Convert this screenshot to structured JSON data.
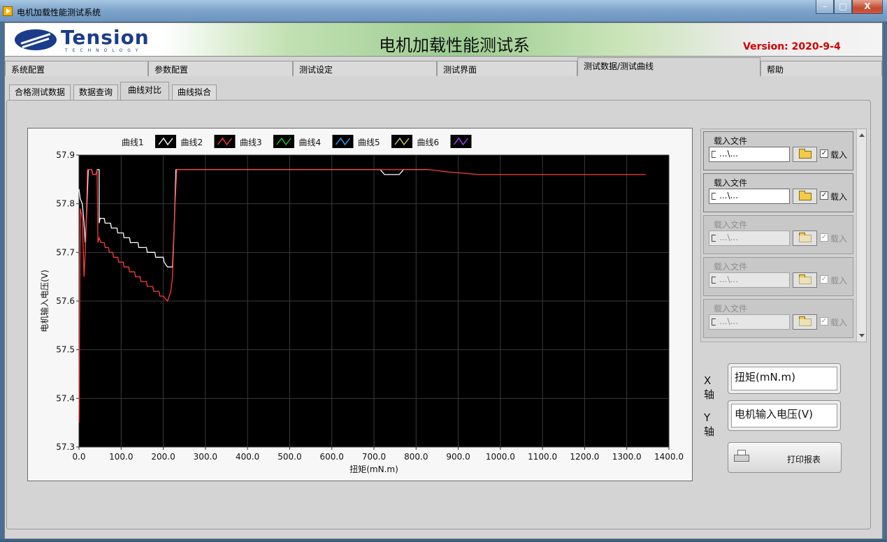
{
  "window": {
    "title": "电机加载性能测试系统",
    "controls": {
      "minimize": "–",
      "maximize": "□",
      "close": "X"
    }
  },
  "header": {
    "logo_text": "Tension",
    "logo_subtext": "TECHNOLOGY",
    "app_title": "电机加载性能测试系",
    "version": "Version: 2020-9-4"
  },
  "top_tabs": [
    "系统配置",
    "参数配置",
    "测试设定",
    "测试界面",
    "测试数据/测试曲线",
    "帮助"
  ],
  "top_tab_active": "测试数据/测试曲线",
  "sub_tabs": [
    "合格测试数据",
    "数据查询",
    "曲线对比",
    "曲线拟合"
  ],
  "sub_tab_active": "曲线对比",
  "legend": [
    "曲线1",
    "曲线2",
    "曲线3",
    "曲线4",
    "曲线5",
    "曲线6"
  ],
  "colors": {
    "plot_bg": "#000000",
    "curve1": "#ffffff",
    "curve2": "#ff3b3b",
    "curve3": "#22cc22",
    "curve4": "#3aa0ff",
    "curve5": "#cfcf5a",
    "curve6": "#b040ff"
  },
  "chart_data": {
    "type": "line",
    "xlabel": "扭矩(mN.m)",
    "ylabel": "电机输入电压(V)",
    "xlim": [
      0,
      1400
    ],
    "ylim": [
      57.3,
      57.9
    ],
    "x_ticks": [
      "0.0",
      "100.0",
      "200.0",
      "300.0",
      "400.0",
      "500.0",
      "600.0",
      "700.0",
      "800.0",
      "900.0",
      "1000.0",
      "1100.0",
      "1200.0",
      "1300.0",
      "1400.0"
    ],
    "y_ticks": [
      "57.3",
      "57.4",
      "57.5",
      "57.6",
      "57.7",
      "57.8",
      "57.9"
    ],
    "grid": true,
    "legend_position": "top",
    "series": [
      {
        "name": "曲线1",
        "points": [
          [
            0,
            57.83
          ],
          [
            3,
            57.81
          ],
          [
            8,
            57.8
          ],
          [
            12,
            57.76
          ],
          [
            15,
            57.72
          ],
          [
            18,
            57.78
          ],
          [
            22,
            57.87
          ],
          [
            30,
            57.87
          ],
          [
            33,
            57.86
          ],
          [
            40,
            57.86
          ],
          [
            43,
            57.87
          ],
          [
            48,
            57.87
          ],
          [
            48,
            57.76
          ],
          [
            50,
            57.77
          ],
          [
            60,
            57.77
          ],
          [
            62,
            57.76
          ],
          [
            75,
            57.76
          ],
          [
            77,
            57.75
          ],
          [
            90,
            57.75
          ],
          [
            92,
            57.74
          ],
          [
            105,
            57.74
          ],
          [
            107,
            57.73
          ],
          [
            120,
            57.73
          ],
          [
            122,
            57.72
          ],
          [
            140,
            57.72
          ],
          [
            142,
            57.71
          ],
          [
            160,
            57.71
          ],
          [
            162,
            57.7
          ],
          [
            180,
            57.7
          ],
          [
            182,
            57.69
          ],
          [
            200,
            57.69
          ],
          [
            202,
            57.68
          ],
          [
            210,
            57.67
          ],
          [
            222,
            57.67
          ],
          [
            226,
            57.75
          ],
          [
            230,
            57.87
          ],
          [
            715,
            57.87
          ],
          [
            725,
            57.86
          ],
          [
            760,
            57.86
          ],
          [
            770,
            57.87
          ],
          [
            830,
            57.87
          ]
        ]
      },
      {
        "name": "曲线2",
        "points": [
          [
            0,
            57.35
          ],
          [
            3,
            57.79
          ],
          [
            8,
            57.77
          ],
          [
            12,
            57.65
          ],
          [
            16,
            57.72
          ],
          [
            20,
            57.87
          ],
          [
            30,
            57.87
          ],
          [
            33,
            57.86
          ],
          [
            40,
            57.86
          ],
          [
            43,
            57.87
          ],
          [
            45,
            57.72
          ],
          [
            48,
            57.73
          ],
          [
            52,
            57.72
          ],
          [
            60,
            57.72
          ],
          [
            62,
            57.71
          ],
          [
            70,
            57.71
          ],
          [
            72,
            57.7
          ],
          [
            80,
            57.7
          ],
          [
            82,
            57.69
          ],
          [
            92,
            57.69
          ],
          [
            94,
            57.68
          ],
          [
            105,
            57.68
          ],
          [
            107,
            57.67
          ],
          [
            118,
            57.67
          ],
          [
            120,
            57.66
          ],
          [
            132,
            57.66
          ],
          [
            134,
            57.65
          ],
          [
            145,
            57.65
          ],
          [
            147,
            57.64
          ],
          [
            160,
            57.64
          ],
          [
            162,
            57.63
          ],
          [
            175,
            57.63
          ],
          [
            177,
            57.62
          ],
          [
            190,
            57.62
          ],
          [
            192,
            57.61
          ],
          [
            200,
            57.61
          ],
          [
            210,
            57.6
          ],
          [
            218,
            57.62
          ],
          [
            222,
            57.65
          ],
          [
            228,
            57.8
          ],
          [
            232,
            57.87
          ],
          [
            830,
            57.87
          ],
          [
            880,
            57.865
          ],
          [
            950,
            57.86
          ],
          [
            1345,
            57.86
          ]
        ]
      }
    ]
  },
  "file_panel": {
    "items": [
      {
        "label": "载入文件",
        "path": "...\\...",
        "checked": true,
        "checkbox_label": "载入",
        "enabled": true
      },
      {
        "label": "载入文件",
        "path": "...\\...",
        "checked": true,
        "checkbox_label": "载入",
        "enabled": true
      },
      {
        "label": "载入文件",
        "path": "...\\...",
        "checked": true,
        "checkbox_label": "载入",
        "enabled": false
      },
      {
        "label": "载入文件",
        "path": "...\\...",
        "checked": true,
        "checkbox_label": "载入",
        "enabled": false
      },
      {
        "label": "载入文件",
        "path": "...\\...",
        "checked": true,
        "checkbox_label": "载入",
        "enabled": false
      }
    ]
  },
  "axis_settings": {
    "x_label": "X轴",
    "x_value": "扭矩(mN.m)",
    "y_label": "Y轴",
    "y_value": "电机输入电压(V)"
  },
  "print_button": "打印报表"
}
